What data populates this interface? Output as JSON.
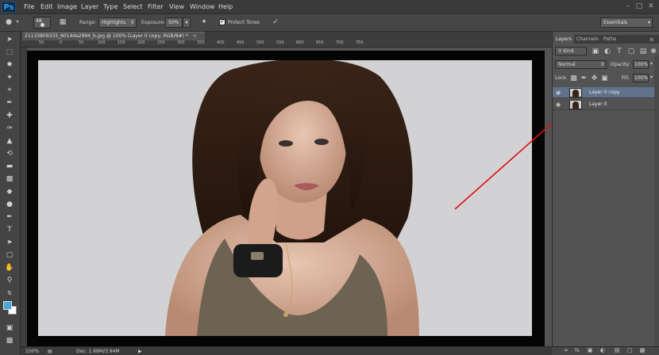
{
  "app": {
    "logo": "Ps"
  },
  "menu": [
    "File",
    "Edit",
    "Image",
    "Layer",
    "Type",
    "Select",
    "Filter",
    "View",
    "Window",
    "Help"
  ],
  "window_controls": {
    "minimize": "–",
    "maximize": "□",
    "close": "✕"
  },
  "options": {
    "brush_size": "48",
    "range_label": "Range:",
    "range_value": "Highlights",
    "exposure_label": "Exposure:",
    "exposure_value": "50%",
    "protect_tones_label": "Protect Tones",
    "protect_tones_checked": true,
    "workspace": "Essentials"
  },
  "document": {
    "tab_title": "21133809333_6014da2994_b.jpg @ 100% (Layer 0 copy, RGB/8#) *",
    "close": "×",
    "ruler_labels": [
      "50",
      "0",
      "50",
      "100",
      "150",
      "200",
      "250",
      "300",
      "350",
      "400",
      "450",
      "500",
      "550",
      "600",
      "650",
      "700",
      "750"
    ]
  },
  "status": {
    "zoom": "100%",
    "doc": "Doc: 1.69M/3.94M"
  },
  "layers_panel": {
    "tabs": [
      "Layers",
      "Channels",
      "Paths"
    ],
    "active_tab": "Layers",
    "filter_label": "Kind",
    "blend_mode": "Normal",
    "opacity_label": "Opacity:",
    "opacity_value": "100%",
    "lock_label": "Lock:",
    "fill_label": "Fill:",
    "fill_value": "100%",
    "layers": [
      {
        "name": "Layer 0 copy",
        "selected": true
      },
      {
        "name": "Layer 0",
        "selected": false
      }
    ]
  },
  "icons": [
    "dodge-tool-icon",
    "eye-icon",
    "lock-icon",
    "link-icon",
    "fx-icon",
    "mask-icon",
    "adjustment-icon",
    "folder-icon",
    "new-layer-icon",
    "trash-icon"
  ],
  "colors": {
    "annotation_arrow": "#e01010",
    "selected_layer": "#5f728a",
    "ps_blue": "#2fa3f5"
  }
}
